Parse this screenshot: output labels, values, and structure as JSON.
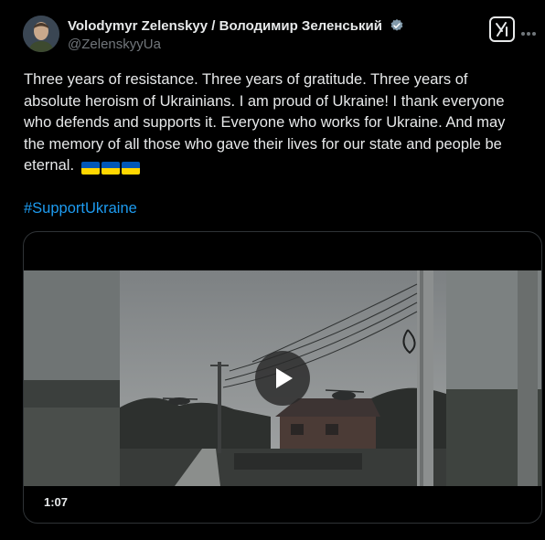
{
  "author": {
    "display_name": "Volodymyr Zelenskyy / Володимир Зеленський",
    "handle": "@ZelenskyyUa",
    "verified_color": "#829aab"
  },
  "post": {
    "text": "Three years of resistance. Three years of gratitude. Three years of absolute heroism of Ukrainians. I am proud of Ukraine! I thank everyone who defends and supports it. Everyone who works for Ukraine. And may the memory of all those who gave their lives for our state and people be eternal.",
    "flags": [
      "ukraine-flag",
      "ukraine-flag",
      "ukraine-flag"
    ],
    "hashtag": "#SupportUkraine"
  },
  "media": {
    "type": "video",
    "duration": "1:07"
  },
  "colors": {
    "background": "#000000",
    "text": "#e7e9ea",
    "secondary": "#71767b",
    "link": "#1d9bf0",
    "flag_blue": "#0057b7",
    "flag_yellow": "#ffd700"
  },
  "icons": [
    "verified-badge-icon",
    "grok-icon",
    "more-icon",
    "play-icon"
  ]
}
